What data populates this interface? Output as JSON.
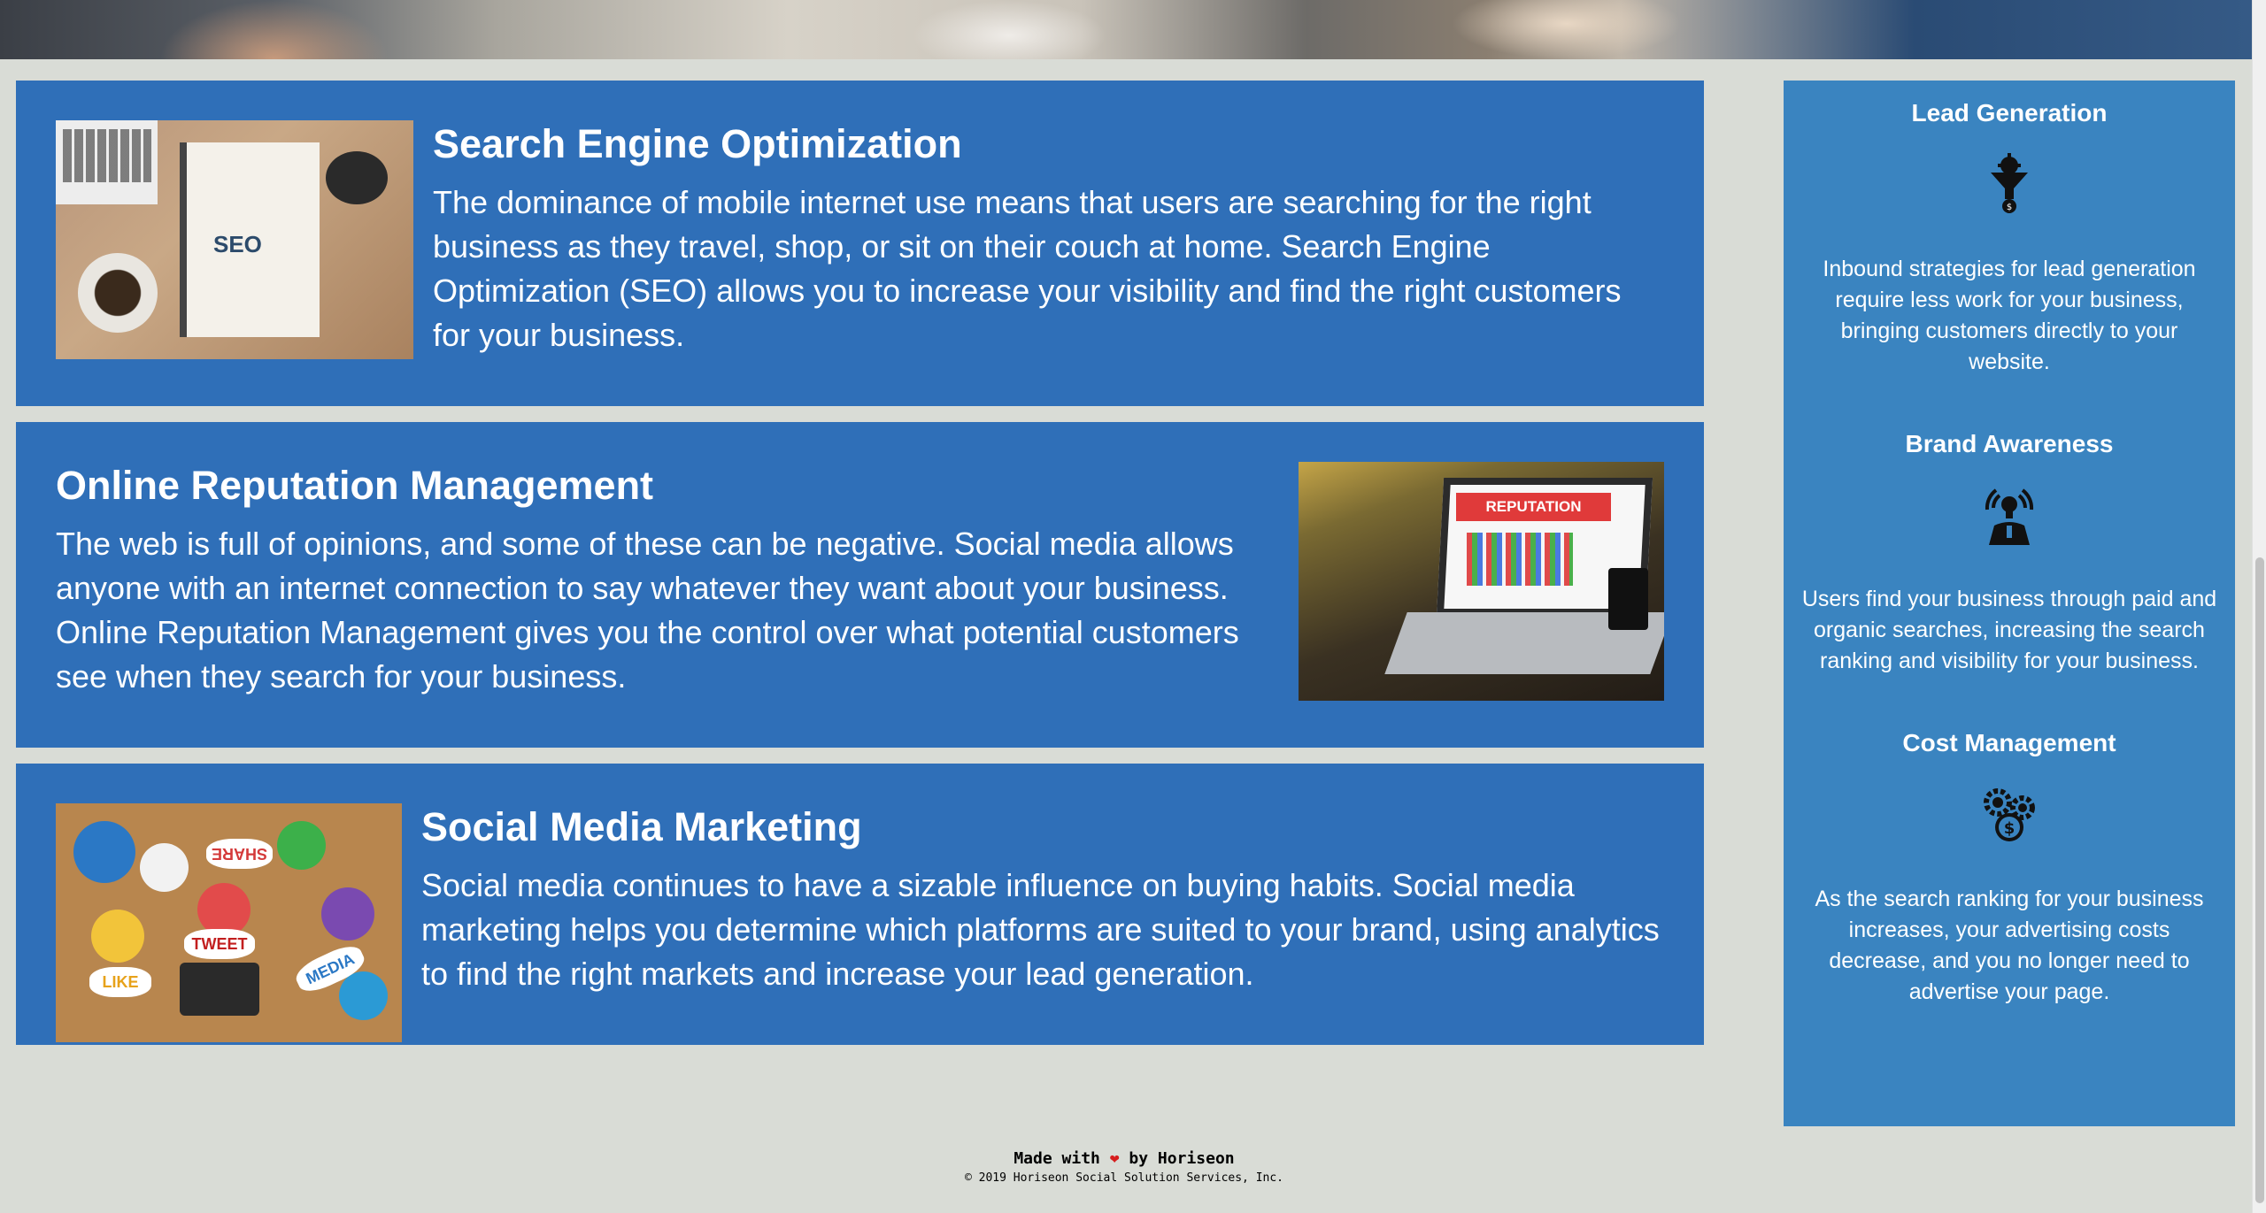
{
  "services": [
    {
      "id": "seo",
      "title": "Search Engine Optimization",
      "text": "The dominance of mobile internet use means that users are searching for the right business as they travel, shop, or sit on their couch at home. Search Engine Optimization (SEO) allows you to increase your visibility and find the right customers for your business.",
      "image_label": "SEO"
    },
    {
      "id": "orm",
      "title": "Online Reputation Management",
      "text": "The web is full of opinions, and some of these can be negative. Social media allows anyone with an internet connection to say whatever they want about your business. Online Reputation Management gives you the control over what potential customers see when they search for your business.",
      "image_label": "REPUTATION"
    },
    {
      "id": "smm",
      "title": "Social Media Marketing",
      "text": "Social media continues to have a sizable influence on buying habits. Social media marketing helps you determine which platforms are suited to your brand, using analytics to find the right markets and increase your lead generation.",
      "image_labels": [
        "SHARE",
        "TWEET",
        "LIKE",
        "MEDIA"
      ]
    }
  ],
  "benefits": [
    {
      "title": "Lead Generation",
      "icon": "lead-funnel-icon",
      "text": "Inbound strategies for lead generation require less work for your business, bringing customers directly to your website."
    },
    {
      "title": "Brand Awareness",
      "icon": "brand-lightbulb-icon",
      "text": "Users find your business through paid and organic searches, increasing the search ranking and visibility for your business."
    },
    {
      "title": "Cost Management",
      "icon": "cost-gears-icon",
      "text": "As the search ranking for your business increases, your advertising costs decrease, and you no longer need to advertise your page."
    }
  ],
  "footer": {
    "made_prefix": "Made with",
    "made_suffix": "by Horiseon",
    "heart_glyph": "❤",
    "copyright": "© 2019 Horiseon Social Solution Services, Inc."
  },
  "colors": {
    "service_bg": "#2f6fb8",
    "sidebar_bg": "#3a84c0",
    "page_bg": "#d9dcd6",
    "heart": "#d61d1d"
  }
}
